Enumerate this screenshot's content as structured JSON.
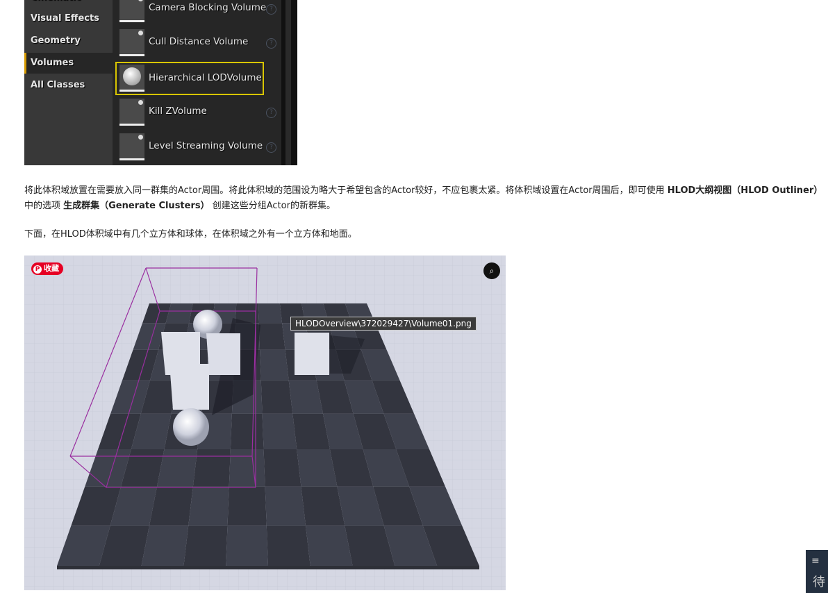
{
  "editor_panel": {
    "categories": [
      {
        "label": "Cinematic"
      },
      {
        "label": "Visual Effects"
      },
      {
        "label": "Geometry"
      },
      {
        "label": "Volumes",
        "selected": true
      },
      {
        "label": "All Classes"
      }
    ],
    "items": [
      {
        "label": "Camera Blocking Volume",
        "icon": "camera-hand-icon"
      },
      {
        "label": "Cull Distance Volume",
        "icon": "eye-slash-icon"
      },
      {
        "label": "Hierarchical LODVolume",
        "icon": "sphere-icon",
        "selected": true
      },
      {
        "label": "Kill ZVolume",
        "icon": "kill-z-icon"
      },
      {
        "label": "Level Streaming Volume",
        "icon": "level-streaming-icon"
      }
    ],
    "help_glyph": "?"
  },
  "article": {
    "para1_a": "将此体积域放置在需要放入同一群集的Actor周围。将此体积域的范围设为略大于希望包含的Actor较好，不应包裹太紧。将体积域设置在Actor周围后，即可使用 ",
    "para1_b": "HLOD大纲视图（HLOD Outliner）",
    "para1_c": " 中的选项 ",
    "para1_d": "生成群集（Generate Clusters）",
    "para1_e": " 创建这些分组Actor的新群集。",
    "para2": "下面，在HLOD体积域中有几个立方体和球体，在体积域之外有一个立方体和地面。"
  },
  "image": {
    "pin_label": "收藏",
    "tooltip": "HLODOverview\\372029427\\Volume01.png",
    "volume_color": "#9a2fa0",
    "floor_rows": 8,
    "floor_cols": 10
  },
  "side_widget": {
    "menu_glyph": "≡",
    "char": "待"
  }
}
